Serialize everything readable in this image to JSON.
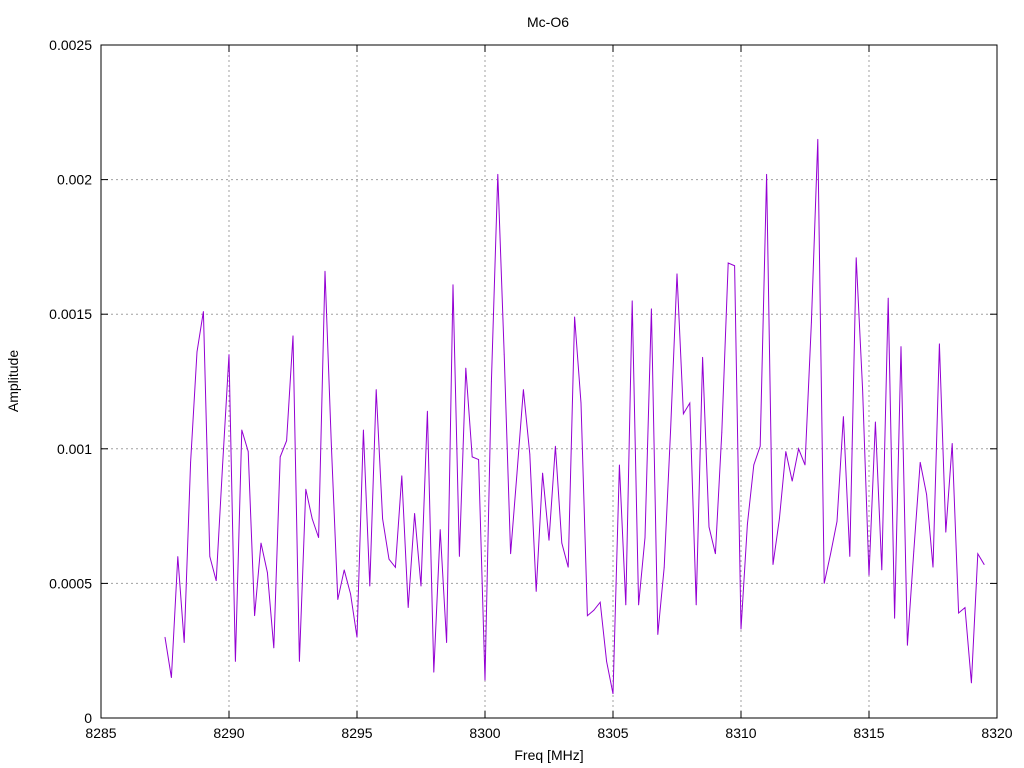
{
  "chart_data": {
    "type": "line",
    "title": "Mc-O6",
    "xlabel": "Freq [MHz]",
    "ylabel": "Amplitude",
    "xlim": [
      8285,
      8320
    ],
    "ylim": [
      0,
      0.0025
    ],
    "xticks": [
      8285,
      8290,
      8295,
      8300,
      8305,
      8310,
      8315,
      8320
    ],
    "xtick_labels": [
      "8285",
      "8290",
      "8295",
      "8300",
      "8305",
      "8310",
      "8315",
      "8320"
    ],
    "yticks": [
      0,
      0.0005,
      0.001,
      0.0015,
      0.002,
      0.0025
    ],
    "ytick_labels": [
      "0",
      "0.0005",
      "0.001",
      "0.0015",
      "0.002",
      "0.0025"
    ],
    "grid": true,
    "line_color": "#9400d3",
    "series": [
      {
        "x": [
          8287.5,
          8287.75,
          8288.0,
          8288.25,
          8288.5,
          8288.75,
          8289.0,
          8289.25,
          8289.5,
          8289.75,
          8290.0,
          8290.25,
          8290.5,
          8290.75,
          8291.0,
          8291.25,
          8291.5,
          8291.75,
          8292.0,
          8292.25,
          8292.5,
          8292.75,
          8293.0,
          8293.25,
          8293.5,
          8293.75,
          8294.0,
          8294.25,
          8294.5,
          8294.75,
          8295.0,
          8295.25,
          8295.5,
          8295.75,
          8296.0,
          8296.25,
          8296.5,
          8296.75,
          8297.0,
          8297.25,
          8297.5,
          8297.75,
          8298.0,
          8298.25,
          8298.5,
          8298.75,
          8299.0,
          8299.25,
          8299.5,
          8299.75,
          8300.0,
          8300.25,
          8300.5,
          8300.75,
          8301.0,
          8301.25,
          8301.5,
          8301.75,
          8302.0,
          8302.25,
          8302.5,
          8302.75,
          8303.0,
          8303.25,
          8303.5,
          8303.75,
          8304.0,
          8304.25,
          8304.5,
          8304.75,
          8305.0,
          8305.25,
          8305.5,
          8305.75,
          8306.0,
          8306.25,
          8306.5,
          8306.75,
          8307.0,
          8307.25,
          8307.5,
          8307.75,
          8308.0,
          8308.25,
          8308.5,
          8308.75,
          8309.0,
          8309.25,
          8309.5,
          8309.75,
          8310.0,
          8310.25,
          8310.5,
          8310.75,
          8311.0,
          8311.25,
          8311.5,
          8311.75,
          8312.0,
          8312.25,
          8312.5,
          8312.75,
          8313.0,
          8313.25,
          8313.5,
          8313.75,
          8314.0,
          8314.25,
          8314.5,
          8314.75,
          8315.0,
          8315.25,
          8315.5,
          8315.75,
          8316.0,
          8316.25,
          8316.5,
          8316.75,
          8317.0,
          8317.25,
          8317.5,
          8317.75,
          8318.0,
          8318.25,
          8318.5,
          8318.75,
          8319.0,
          8319.25,
          8319.5
        ],
        "y": [
          0.0003,
          0.00015,
          0.0006,
          0.00028,
          0.00095,
          0.00136,
          0.00151,
          0.0006,
          0.00051,
          0.00094,
          0.00135,
          0.00021,
          0.00107,
          0.00099,
          0.00038,
          0.00065,
          0.00054,
          0.00026,
          0.00097,
          0.00103,
          0.00142,
          0.00021,
          0.00085,
          0.00074,
          0.00067,
          0.00166,
          0.00101,
          0.00044,
          0.00055,
          0.00046,
          0.0003,
          0.00107,
          0.00049,
          0.00122,
          0.00074,
          0.00059,
          0.00056,
          0.0009,
          0.00041,
          0.00076,
          0.00049,
          0.00114,
          0.00017,
          0.0007,
          0.00028,
          0.00161,
          0.0006,
          0.0013,
          0.00097,
          0.00096,
          0.00014,
          0.00125,
          0.00202,
          0.00135,
          0.00061,
          0.00091,
          0.00122,
          0.00098,
          0.00047,
          0.00091,
          0.00066,
          0.00101,
          0.00065,
          0.00056,
          0.00149,
          0.00117,
          0.00038,
          0.0004,
          0.00043,
          0.00021,
          9e-05,
          0.00094,
          0.00042,
          0.00155,
          0.00042,
          0.00067,
          0.00152,
          0.00031,
          0.00056,
          0.00107,
          0.00165,
          0.00113,
          0.00117,
          0.00042,
          0.00134,
          0.00071,
          0.00061,
          0.00106,
          0.00169,
          0.00168,
          0.00033,
          0.00072,
          0.00094,
          0.00101,
          0.00202,
          0.00057,
          0.00074,
          0.00099,
          0.00088,
          0.001,
          0.00094,
          0.00147,
          0.00215,
          0.0005,
          0.00061,
          0.00073,
          0.00112,
          0.0006,
          0.00171,
          0.00122,
          0.00053,
          0.0011,
          0.00055,
          0.00156,
          0.00037,
          0.00138,
          0.00027,
          0.00062,
          0.00095,
          0.00083,
          0.00056,
          0.00139,
          0.00069,
          0.00102,
          0.00039,
          0.00041,
          0.00013,
          0.00061,
          0.00057
        ]
      }
    ]
  }
}
